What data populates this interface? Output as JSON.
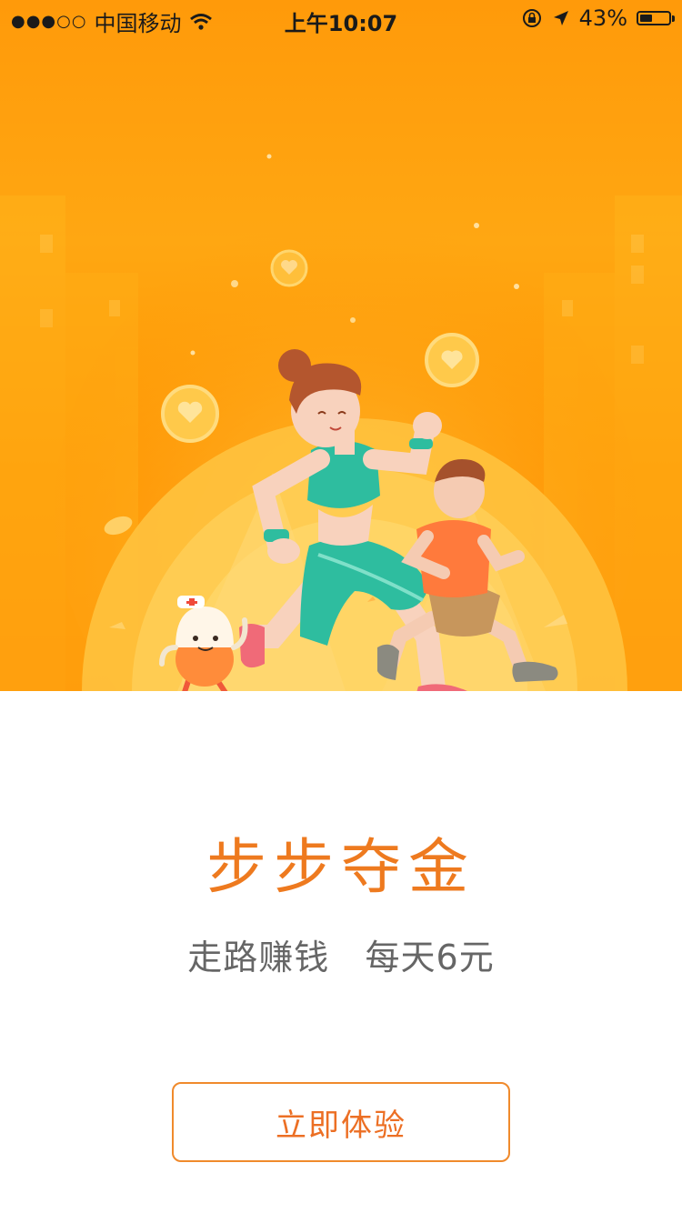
{
  "status_bar": {
    "signal": "●●●○○",
    "carrier": "中国移动",
    "time": "上午10:07",
    "battery_percent": "43%",
    "battery_level": 0.43,
    "icons": [
      "wifi-icon",
      "orientation-lock-icon",
      "location-icon",
      "battery-icon"
    ]
  },
  "hero": {
    "illustration": "woman-boy-pill-running-illustration",
    "colors": {
      "bg": "#ff9a0a",
      "sun": "#ffcf4a",
      "coin": "#ffc94a"
    }
  },
  "content": {
    "title": "步步夺金",
    "subtitle": "走路赚钱   每天6元"
  },
  "cta": {
    "label": "立即体验",
    "color": "#ec6f24"
  }
}
